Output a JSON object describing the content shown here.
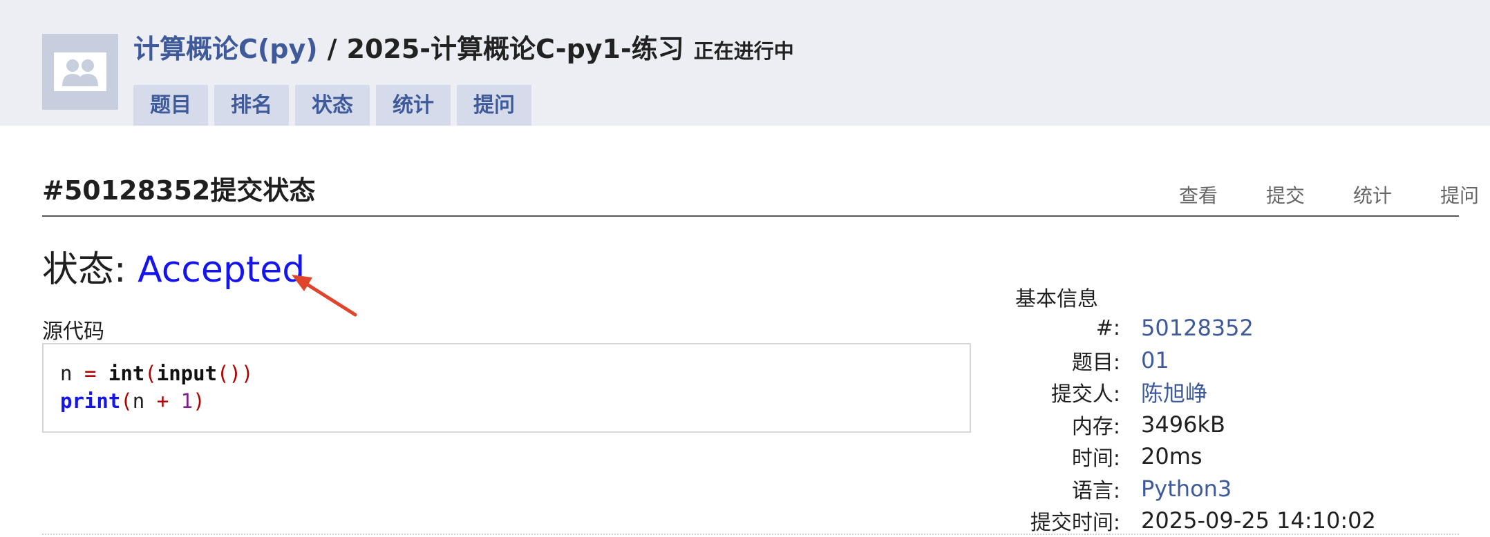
{
  "header": {
    "course": "计算概论C(py)",
    "separator": "/",
    "contest": "2025-计算概论C-py1-练习",
    "contest_status": "正在进行中",
    "tabs": [
      "题目",
      "排名",
      "状态",
      "统计",
      "提问"
    ]
  },
  "submission": {
    "title": "#50128352提交状态",
    "actions": [
      "查看",
      "提交",
      "统计",
      "提问"
    ],
    "status_label": "状态:",
    "status_value": "Accepted",
    "source_label": "源代码"
  },
  "code": {
    "line1": {
      "var": "n",
      "op": "=",
      "fn1": "int",
      "open1": "(",
      "fn2": "input",
      "parens": "())"
    },
    "line2": {
      "fn": "print",
      "open": "(",
      "var": "n",
      "op": "+",
      "num": "1",
      "close": ")"
    }
  },
  "info": {
    "title": "基本信息",
    "rows": [
      {
        "key": "#:",
        "value": "50128352"
      },
      {
        "key": "题目:",
        "value": "01"
      },
      {
        "key": "提交人:",
        "value": "陈旭峥"
      },
      {
        "key": "内存:",
        "value": "3496kB"
      },
      {
        "key": "时间:",
        "value": "20ms"
      },
      {
        "key": "语言:",
        "value": "Python3"
      },
      {
        "key": "提交时间:",
        "value": "2025-09-25 14:10:02"
      }
    ]
  },
  "colors": {
    "accent_link": "#3e5a9a",
    "accepted": "#1414ee",
    "annotation_arrow": "#e0452b",
    "header_bg": "#eceef4"
  },
  "icons": {
    "avatar": "group-avatar-icon",
    "annotation": "red-arrow-icon"
  }
}
